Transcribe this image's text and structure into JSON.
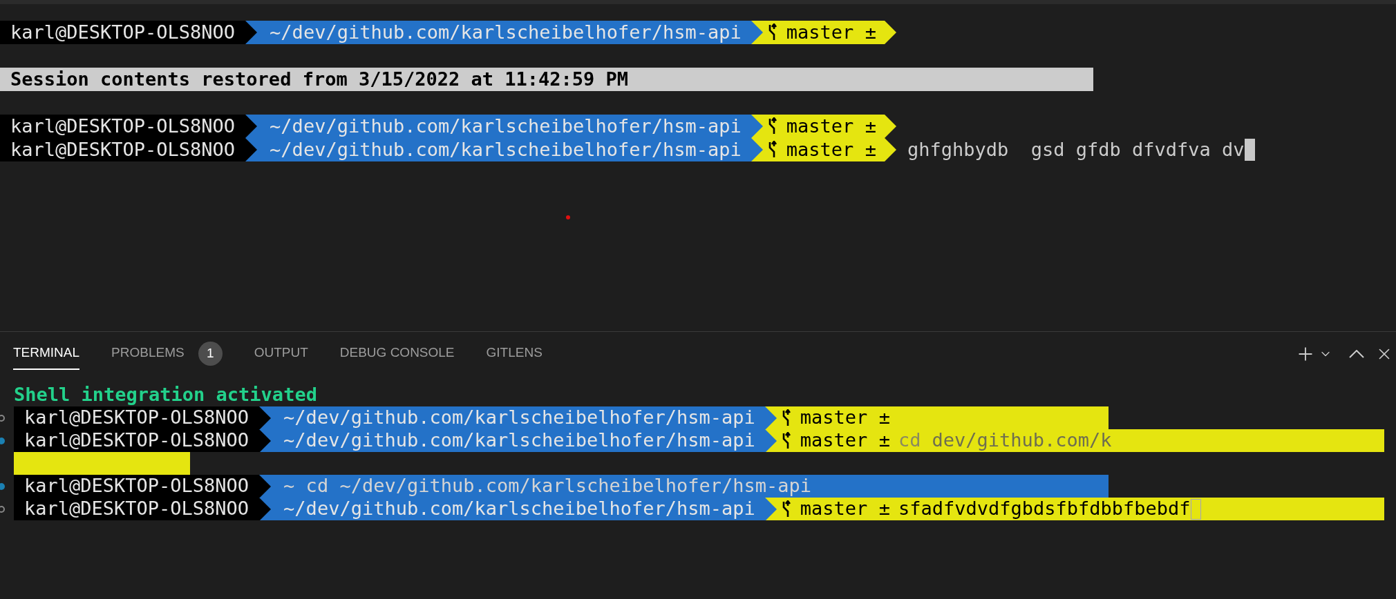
{
  "editor_terminal": {
    "lines": [
      {
        "kind": "prompt",
        "user": "karl@DESKTOP-OLS8NOO",
        "path": "~/dev/github.com/karlscheibelhofer/hsm-api",
        "branch": "master ±"
      },
      {
        "kind": "banner",
        "text": "Session contents restored from 3/15/2022 at 11:42:59 PM"
      },
      {
        "kind": "prompt",
        "user": "karl@DESKTOP-OLS8NOO",
        "path": "~/dev/github.com/karlscheibelhofer/hsm-api",
        "branch": "master ±"
      },
      {
        "kind": "prompt",
        "user": "karl@DESKTOP-OLS8NOO",
        "path": "~/dev/github.com/karlscheibelhofer/hsm-api",
        "branch": "master ±",
        "command": "ghfghbydb  gsd gfdb dfvdfva dv",
        "cursor": true
      }
    ]
  },
  "panel": {
    "tabs": [
      {
        "label": "TERMINAL",
        "selected": true
      },
      {
        "label": "PROBLEMS",
        "selected": false,
        "badge": "1"
      },
      {
        "label": "OUTPUT",
        "selected": false
      },
      {
        "label": "DEBUG CONSOLE",
        "selected": false
      },
      {
        "label": "GITLENS",
        "selected": false
      }
    ]
  },
  "terminal": {
    "notice": "Shell integration activated",
    "lines": [
      {
        "kind": "prompt",
        "marker_filled": false,
        "full_width": false,
        "user": "karl@DESKTOP-OLS8NOO",
        "path": "~/dev/github.com/karlscheibelhofer/hsm-api",
        "branch": "master ±"
      },
      {
        "kind": "prompt",
        "marker_filled": true,
        "full_width": true,
        "user": "karl@DESKTOP-OLS8NOO",
        "path": "~/dev/github.com/karlscheibelhofer/hsm-api",
        "branch": "master ±",
        "command": "cd",
        "suggestion": "dev/github.com/k"
      },
      {
        "kind": "wrap"
      },
      {
        "kind": "cd",
        "marker_filled": true,
        "full_width": false,
        "user": "karl@DESKTOP-OLS8NOO",
        "command": "~ cd ~/dev/github.com/karlscheibelhofer/hsm-api"
      },
      {
        "kind": "prompt",
        "marker_filled": false,
        "full_width": true,
        "user": "karl@DESKTOP-OLS8NOO",
        "path": "~/dev/github.com/karlscheibelhofer/hsm-api",
        "branch": "master ±",
        "command": "sfadfvdvdfgbdsfbfdbbfbebdf",
        "cursor": true
      }
    ]
  }
}
